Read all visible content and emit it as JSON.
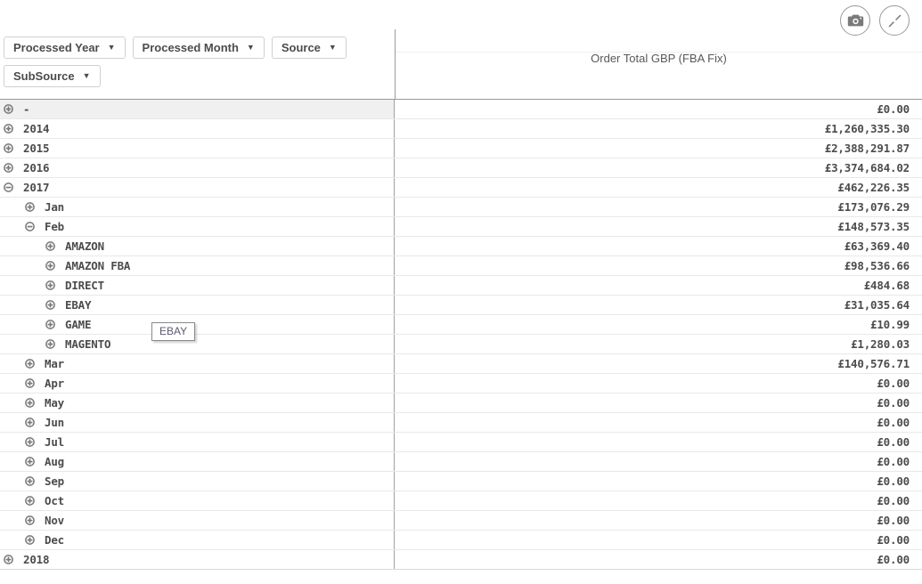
{
  "toolbar": {
    "snapshot_icon": "camera-icon",
    "fullscreen_icon": "expand-arrows-icon"
  },
  "filters": [
    {
      "label": "Processed Year",
      "icon": "chevron-down-icon"
    },
    {
      "label": "Processed Month",
      "icon": "chevron-down-icon"
    },
    {
      "label": "Source",
      "icon": "chevron-down-icon"
    },
    {
      "label": "SubSource",
      "icon": "chevron-down-icon"
    }
  ],
  "table": {
    "measure_header": "Order Total GBP (FBA Fix)",
    "rows": [
      {
        "label": "-",
        "value": "£0.00",
        "level": 0,
        "state": "collapsed",
        "highlight": true
      },
      {
        "label": "2014",
        "value": "£1,260,335.30",
        "level": 0,
        "state": "collapsed",
        "highlight": false
      },
      {
        "label": "2015",
        "value": "£2,388,291.87",
        "level": 0,
        "state": "collapsed",
        "highlight": false
      },
      {
        "label": "2016",
        "value": "£3,374,684.02",
        "level": 0,
        "state": "collapsed",
        "highlight": false
      },
      {
        "label": "2017",
        "value": "£462,226.35",
        "level": 0,
        "state": "expanded",
        "highlight": false
      },
      {
        "label": "Jan",
        "value": "£173,076.29",
        "level": 1,
        "state": "collapsed",
        "highlight": false
      },
      {
        "label": "Feb",
        "value": "£148,573.35",
        "level": 1,
        "state": "expanded",
        "highlight": false
      },
      {
        "label": "AMAZON",
        "value": "£63,369.40",
        "level": 2,
        "state": "collapsed",
        "highlight": false
      },
      {
        "label": "AMAZON FBA",
        "value": "£98,536.66",
        "level": 2,
        "state": "collapsed",
        "highlight": false
      },
      {
        "label": "DIRECT",
        "value": "£484.68",
        "level": 2,
        "state": "collapsed",
        "highlight": false
      },
      {
        "label": "EBAY",
        "value": "£31,035.64",
        "level": 2,
        "state": "collapsed",
        "highlight": false
      },
      {
        "label": "GAME",
        "value": "£10.99",
        "level": 2,
        "state": "collapsed",
        "highlight": false
      },
      {
        "label": "MAGENTO",
        "value": "£1,280.03",
        "level": 2,
        "state": "collapsed",
        "highlight": false
      },
      {
        "label": "Mar",
        "value": "£140,576.71",
        "level": 1,
        "state": "collapsed",
        "highlight": false
      },
      {
        "label": "Apr",
        "value": "£0.00",
        "level": 1,
        "state": "collapsed",
        "highlight": false
      },
      {
        "label": "May",
        "value": "£0.00",
        "level": 1,
        "state": "collapsed",
        "highlight": false
      },
      {
        "label": "Jun",
        "value": "£0.00",
        "level": 1,
        "state": "collapsed",
        "highlight": false
      },
      {
        "label": "Jul",
        "value": "£0.00",
        "level": 1,
        "state": "collapsed",
        "highlight": false
      },
      {
        "label": "Aug",
        "value": "£0.00",
        "level": 1,
        "state": "collapsed",
        "highlight": false
      },
      {
        "label": "Sep",
        "value": "£0.00",
        "level": 1,
        "state": "collapsed",
        "highlight": false
      },
      {
        "label": "Oct",
        "value": "£0.00",
        "level": 1,
        "state": "collapsed",
        "highlight": false
      },
      {
        "label": "Nov",
        "value": "£0.00",
        "level": 1,
        "state": "collapsed",
        "highlight": false
      },
      {
        "label": "Dec",
        "value": "£0.00",
        "level": 1,
        "state": "collapsed",
        "highlight": false
      },
      {
        "label": "2018",
        "value": "£0.00",
        "level": 0,
        "state": "collapsed",
        "highlight": false
      }
    ]
  },
  "tooltip": {
    "text": "EBAY"
  },
  "colors": {
    "text": "#4c4c4c",
    "header_text": "#595959",
    "row_border": "#e8e8e8",
    "divider": "#9a9a9a",
    "highlight_bg": "#f0f0f0",
    "icon_stroke": "#7a7a7a"
  }
}
